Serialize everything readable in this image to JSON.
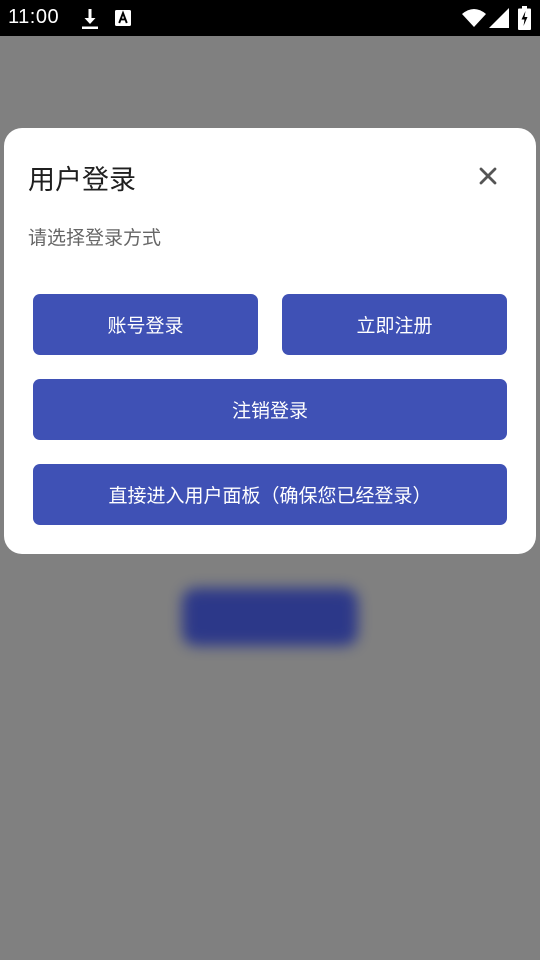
{
  "status_bar": {
    "time": "11:00",
    "icons": [
      "download-icon",
      "font-icon",
      "wifi-icon",
      "signal-icon",
      "battery-charging-icon"
    ]
  },
  "dialog": {
    "title": "用户登录",
    "subtitle": "请选择登录方式",
    "close_icon": "close-icon",
    "buttons": {
      "account_login": "账号登录",
      "register": "立即注册",
      "logout": "注销登录",
      "user_panel": "直接进入用户面板（确保您已经登录）"
    }
  },
  "colors": {
    "accent": "#3f51b5",
    "scrim": "#808080",
    "dialog_bg": "#ffffff",
    "status_bar": "#000000"
  }
}
